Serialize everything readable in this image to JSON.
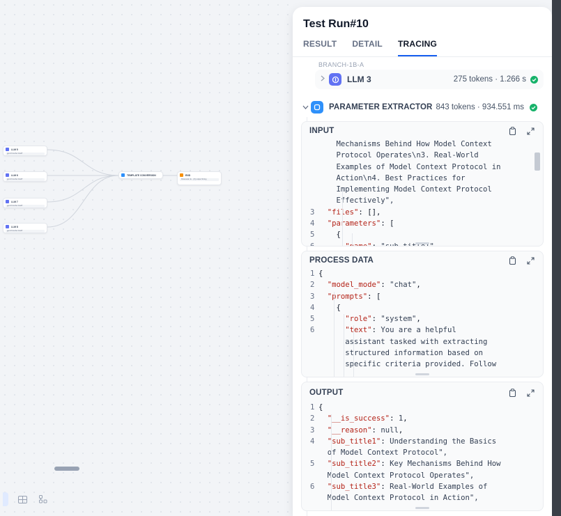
{
  "canvas": {
    "nodes": [
      {
        "title": "LLM 5",
        "sub": "gpt-3.5-turbo CHAT"
      },
      {
        "title": "LLM 6",
        "sub": "gpt-3.5-turbo CHAT"
      },
      {
        "title": "LLM 7",
        "sub": "gpt-3.5-turbo CHAT"
      },
      {
        "title": "LLM 8",
        "sub": "gpt-3.5-turbo CHAT"
      },
      {
        "title": "TEMPLATE CONVERSION",
        "sub": ""
      },
      {
        "title": "END",
        "sub": "Parameter E... {X} output String"
      }
    ]
  },
  "panel": {
    "title": "Test Run#10",
    "tabs": [
      {
        "label": "RESULT",
        "active": false
      },
      {
        "label": "DETAIL",
        "active": false
      },
      {
        "label": "TRACING",
        "active": true
      }
    ],
    "branch_label": "BRANCH-1B-A",
    "llm_row": {
      "name": "LLM 3",
      "meta": "275 tokens · 1.266 s",
      "status": "success"
    },
    "extractor": {
      "name": "PARAMETER EXTRACTOR",
      "meta": "843 tokens · 934.551 ms",
      "status": "success"
    },
    "input": {
      "label": "INPUT",
      "lines": [
        {
          "n": "",
          "t": "    Mechanisms Behind How Model Context"
        },
        {
          "n": "",
          "t": "    Protocol Operates\\n3. Real-World"
        },
        {
          "n": "",
          "t": "    Examples of Model Context Protocol in"
        },
        {
          "n": "",
          "t": "    Action\\n4. Best Practices for"
        },
        {
          "n": "",
          "t": "    Implementing Model Context Protocol"
        },
        {
          "n": "",
          "t": "    Effectively\","
        },
        {
          "n": "3",
          "t": "  \"files\": [],"
        },
        {
          "n": "4",
          "t": "  \"parameters\": ["
        },
        {
          "n": "5",
          "t": "    {"
        },
        {
          "n": "6",
          "t": "      \"name\": \"sub_title1\","
        }
      ]
    },
    "process": {
      "label": "PROCESS DATA",
      "lines": [
        {
          "n": "1",
          "t": "{"
        },
        {
          "n": "2",
          "t": "  \"model_mode\": \"chat\","
        },
        {
          "n": "3",
          "t": "  \"prompts\": ["
        },
        {
          "n": "4",
          "t": "    {"
        },
        {
          "n": "5",
          "t": "      \"role\": \"system\","
        },
        {
          "n": "6",
          "t": "      \"text\": \"You are a helpful"
        },
        {
          "n": "",
          "t": "      assistant tasked with extracting"
        },
        {
          "n": "",
          "t": "      structured information based on"
        },
        {
          "n": "",
          "t": "      specific criteria provided. Follow"
        }
      ]
    },
    "output": {
      "label": "OUTPUT",
      "lines": [
        {
          "n": "1",
          "t": "{"
        },
        {
          "n": "2",
          "t": "  \"__is_success\": 1,"
        },
        {
          "n": "3",
          "t": "  \"__reason\": null,"
        },
        {
          "n": "4",
          "t": "  \"sub_title1\": \"Understanding the Basics"
        },
        {
          "n": "",
          "t": "  of Model Context Protocol\","
        },
        {
          "n": "5",
          "t": "  \"sub_title2\": \"Key Mechanisms Behind How"
        },
        {
          "n": "",
          "t": "  Model Context Protocol Operates\","
        },
        {
          "n": "6",
          "t": "  \"sub_title3\": \"Real-World Examples of"
        },
        {
          "n": "",
          "t": "  Model Context Protocol in Action\","
        }
      ]
    }
  },
  "colors": {
    "accent": "#155eef",
    "success": "#17b26a",
    "llm_icon": "#6172f3",
    "extractor_icon": "#2e90fa",
    "json_key": "#b42318"
  }
}
